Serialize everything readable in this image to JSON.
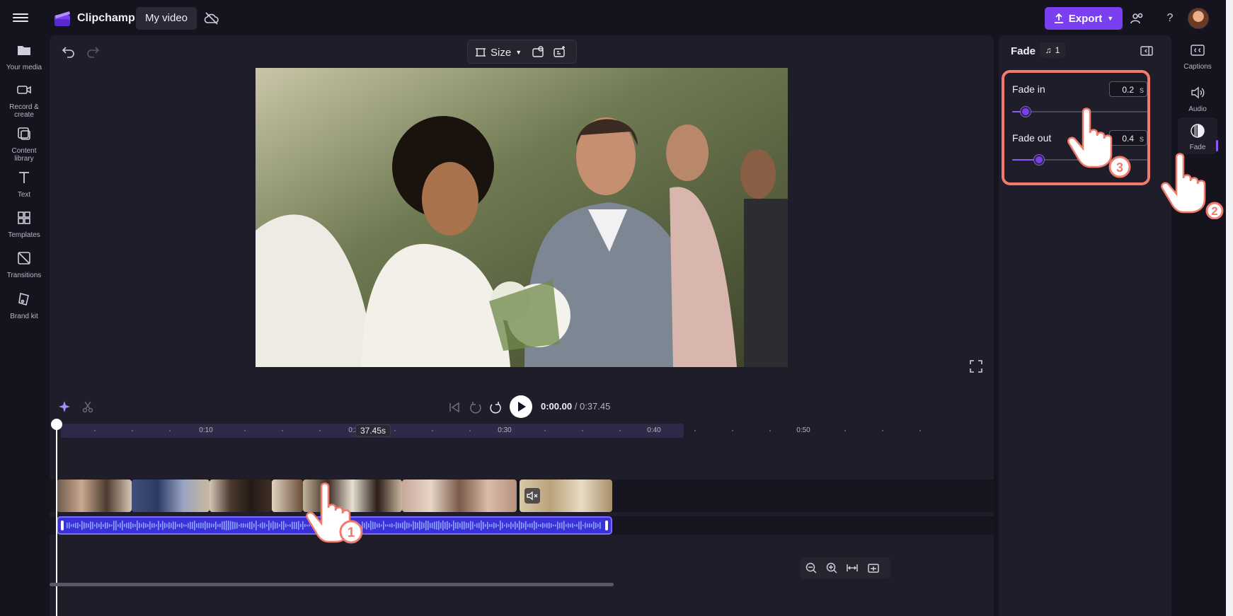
{
  "header": {
    "brand": "Clipchamp",
    "project_title": "My video",
    "export_label": "Export"
  },
  "sidebar": {
    "items": [
      {
        "label": "Your media",
        "icon": "folder-icon"
      },
      {
        "label": "Record &\ncreate",
        "icon": "camera-icon"
      },
      {
        "label": "Content\nlibrary",
        "icon": "content-library-icon"
      },
      {
        "label": "Text",
        "icon": "text-icon"
      },
      {
        "label": "Templates",
        "icon": "templates-icon"
      },
      {
        "label": "Transitions",
        "icon": "transitions-icon"
      },
      {
        "label": "Brand kit",
        "icon": "brand-kit-icon"
      }
    ]
  },
  "preview_toolbar": {
    "size_label": "Size"
  },
  "playback": {
    "current_time": "0:00.00",
    "total_time": "/ 0:37.45"
  },
  "timeline": {
    "ruler_labels": [
      "0:10",
      "0:20",
      "0:30",
      "0:40",
      "0:50"
    ],
    "duration_badge": "37.45s"
  },
  "fade_panel": {
    "title": "Fade",
    "audio_track_number": "1",
    "fade_in_label": "Fade in",
    "fade_in_value": "0.2",
    "fade_in_unit": "s",
    "fade_in_fraction": 0.1,
    "fade_out_label": "Fade out",
    "fade_out_value": "0.4",
    "fade_out_unit": "s",
    "fade_out_fraction": 0.2
  },
  "right_rail": {
    "items": [
      {
        "label": "Captions",
        "icon": "captions-icon"
      },
      {
        "label": "Audio",
        "icon": "speaker-icon"
      },
      {
        "label": "Fade",
        "icon": "fade-icon",
        "active": true
      }
    ]
  },
  "step_markers": [
    "1",
    "2",
    "3"
  ],
  "colors": {
    "accent": "#7b3ff2",
    "audio_clip": "#3a32d8",
    "highlight": "#f07a6b"
  }
}
